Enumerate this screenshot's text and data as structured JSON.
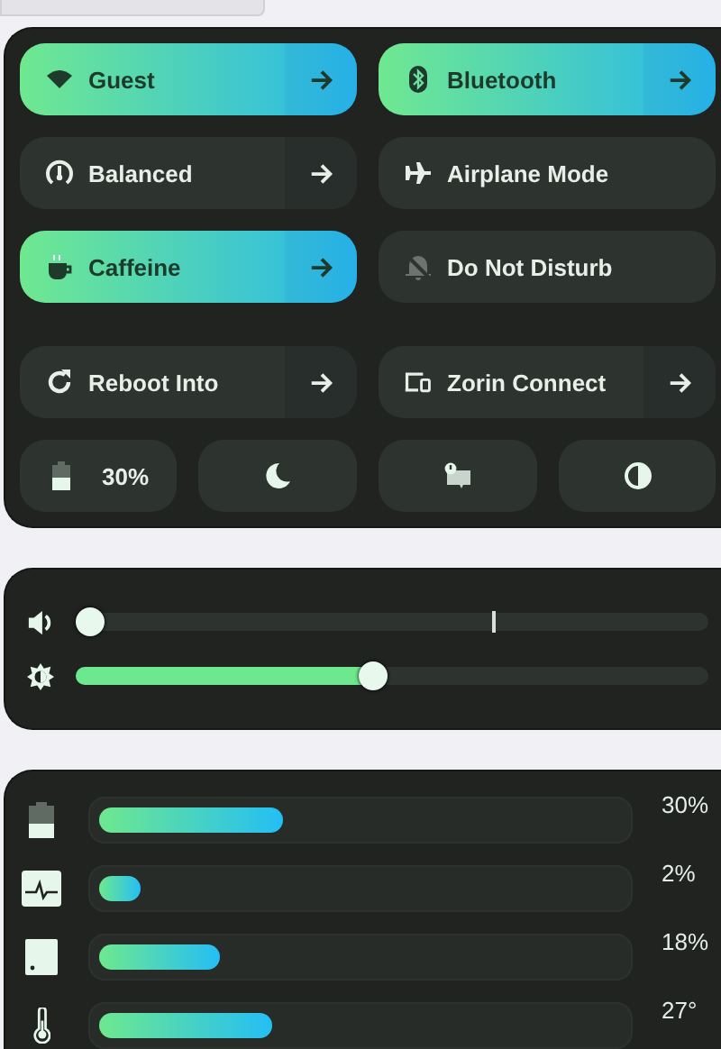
{
  "quick_settings": {
    "tiles": [
      {
        "label": "Guest",
        "on": true,
        "menu": true
      },
      {
        "label": "Bluetooth",
        "on": true,
        "menu": true
      },
      {
        "label": "Balanced",
        "on": false,
        "menu": true
      },
      {
        "label": "Airplane Mode",
        "on": false,
        "menu": false
      },
      {
        "label": "Caffeine",
        "on": true,
        "menu": true
      },
      {
        "label": "Do Not Disturb",
        "on": false,
        "menu": false
      },
      {
        "label": "Reboot Into",
        "on": false,
        "menu": true
      },
      {
        "label": "Zorin Connect",
        "on": false,
        "menu": true
      }
    ],
    "bottom_buttons": [
      {
        "kind": "battery",
        "label": "30%"
      },
      {
        "kind": "night"
      },
      {
        "kind": "notice"
      },
      {
        "kind": "contrast"
      }
    ]
  },
  "sliders": [
    {
      "kind": "volume",
      "level": 0
    },
    {
      "kind": "brightness",
      "level": 0.47
    }
  ],
  "monitors": [
    {
      "kind": "battery",
      "level": 0.35,
      "reading": "30%"
    },
    {
      "kind": "cpu",
      "level": 0.08,
      "reading": "2%"
    },
    {
      "kind": "storage",
      "level": 0.23,
      "reading": "18%"
    },
    {
      "kind": "temperature",
      "level": 0.33,
      "reading": "27°"
    }
  ]
}
